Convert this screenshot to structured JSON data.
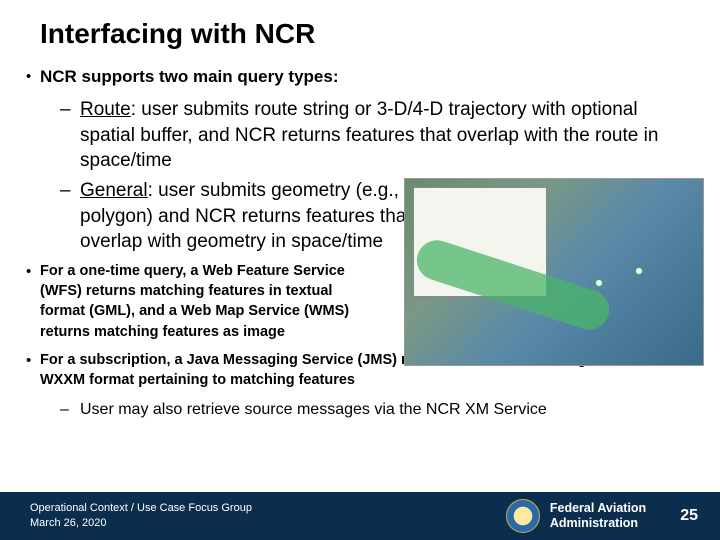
{
  "title": "Interfacing with NCR",
  "main_bullet": "NCR supports two main query types:",
  "sub_route_label": "Route",
  "sub_route_rest": ": user submits route string or 3-D/4-D trajectory with optional spatial buffer, and NCR returns features that overlap with the route in space/time",
  "sub_general_label": "General",
  "sub_general_rest": ": user submits geometry (e.g., polygon) and NCR returns features that overlap with geometry in space/time",
  "bullet_wfs": "For a one-time query, a Web Feature Service (WFS) returns matching features in textual format (GML), and a Web Map Service (WMS) returns matching features as image",
  "bullet_jms": "For a subscription, a Java Messaging Service (JMS) returns the source messages in AIXM or WXXM format pertaining to matching features",
  "sub_xm": "User may also retrieve source messages via the NCR XM Service",
  "footer": {
    "group": "Operational Context / Use Case Focus Group",
    "date": "March 26, 2020",
    "agency": "Federal Aviation Administration",
    "page": "25"
  }
}
